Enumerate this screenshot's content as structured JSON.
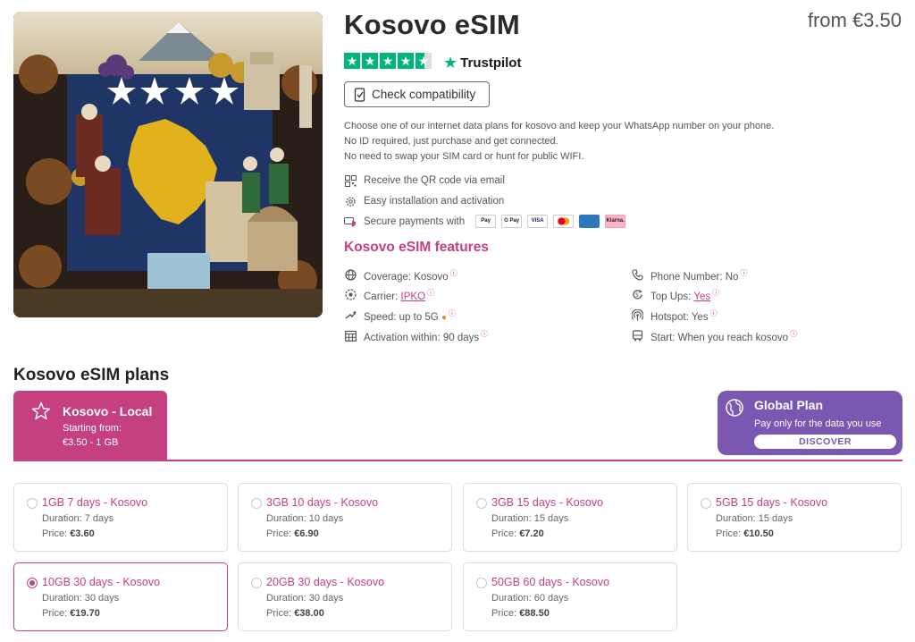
{
  "header": {
    "title": "Kosovo eSIM",
    "price_from": "from €3.50"
  },
  "rating": {
    "stars": 4.5,
    "provider": "Trustpilot"
  },
  "check_compatibility_label": "Check compatibility",
  "description": [
    "Choose one of our internet data plans for kosovo and keep your WhatsApp number on your phone.",
    "No ID required, just purchase and get connected.",
    "No need to swap your SIM card or hunt for public WIFI."
  ],
  "benefits": {
    "qr": "Receive the QR code via email",
    "install": "Easy installation and activation",
    "payments": "Secure payments with",
    "payment_methods": [
      "Pay",
      "G Pay",
      "VISA",
      "MC",
      "AMEX",
      "Klarna."
    ]
  },
  "features": {
    "title": "Kosovo eSIM features",
    "coverage_label": "Coverage: Kosovo",
    "carrier_label": "Carrier:",
    "carrier_value": "IPKO",
    "speed_label": "Speed: up to 5G",
    "activation_label": "Activation within: 90 days",
    "phone_label": "Phone Number: No",
    "topups_label": "Top Ups:",
    "topups_value": "Yes",
    "hotspot_label": "Hotspot: Yes",
    "start_label": "Start: When you reach kosovo",
    "info_mark": "ⓘ"
  },
  "plans": {
    "title": "Kosovo eSIM plans",
    "local_tab": {
      "name": "Kosovo - Local",
      "starting": "Starting from:",
      "price": "€3.50 - 1 GB"
    },
    "global": {
      "name": "Global Plan",
      "desc": "Pay only for the data you use",
      "button": "DISCOVER"
    },
    "duration_prefix": "Duration:",
    "price_prefix": "Price:",
    "items": [
      {
        "name": "1GB 7 days - Kosovo",
        "duration": "7 days",
        "price": "€3.60"
      },
      {
        "name": "3GB 10 days - Kosovo",
        "duration": "10 days",
        "price": "€6.90"
      },
      {
        "name": "3GB 15 days - Kosovo",
        "duration": "15 days",
        "price": "€7.20"
      },
      {
        "name": "5GB 15 days - Kosovo",
        "duration": "15 days",
        "price": "€10.50"
      },
      {
        "name": "10GB 30 days - Kosovo",
        "duration": "30 days",
        "price": "€19.70"
      },
      {
        "name": "20GB 30 days - Kosovo",
        "duration": "30 days",
        "price": "€38.00"
      },
      {
        "name": "50GB 60 days - Kosovo",
        "duration": "60 days",
        "price": "€88.50"
      }
    ],
    "selected_index": 4
  },
  "colors": {
    "accent": "#c4407f",
    "global_purple": "#7a57b0",
    "trustpilot_green": "#00b67a"
  }
}
